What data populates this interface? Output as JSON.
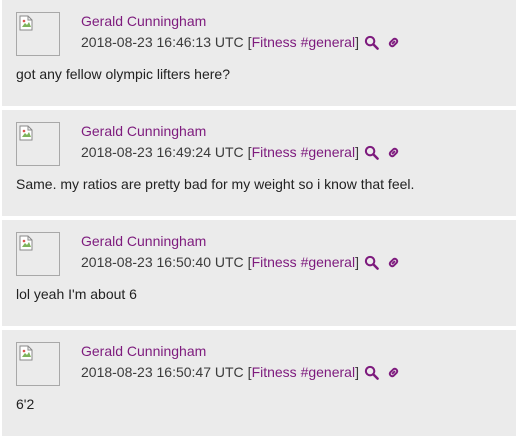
{
  "theme": {
    "accent": "#7d1a7d",
    "card_bg": "#ebebeb",
    "text": "#222222"
  },
  "posts": [
    {
      "author": "Gerald Cunningham",
      "timestamp": "2018-08-23 16:46:13 UTC",
      "channel": "Fitness #general",
      "body": "got any fellow olympic lifters here?"
    },
    {
      "author": "Gerald Cunningham",
      "timestamp": "2018-08-23 16:49:24 UTC",
      "channel": "Fitness #general",
      "body": "Same. my ratios are pretty bad for my weight so i know that feel."
    },
    {
      "author": "Gerald Cunningham",
      "timestamp": "2018-08-23 16:50:40 UTC",
      "channel": "Fitness #general",
      "body": "lol yeah I'm about 6"
    },
    {
      "author": "Gerald Cunningham",
      "timestamp": "2018-08-23 16:50:47 UTC",
      "channel": "Fitness #general",
      "body": "6'2"
    }
  ],
  "punctuation": {
    "open_bracket": "[",
    "close_bracket": "]"
  },
  "icons": {
    "search": "search-icon",
    "link": "link-icon",
    "avatar": "broken-image-icon"
  }
}
